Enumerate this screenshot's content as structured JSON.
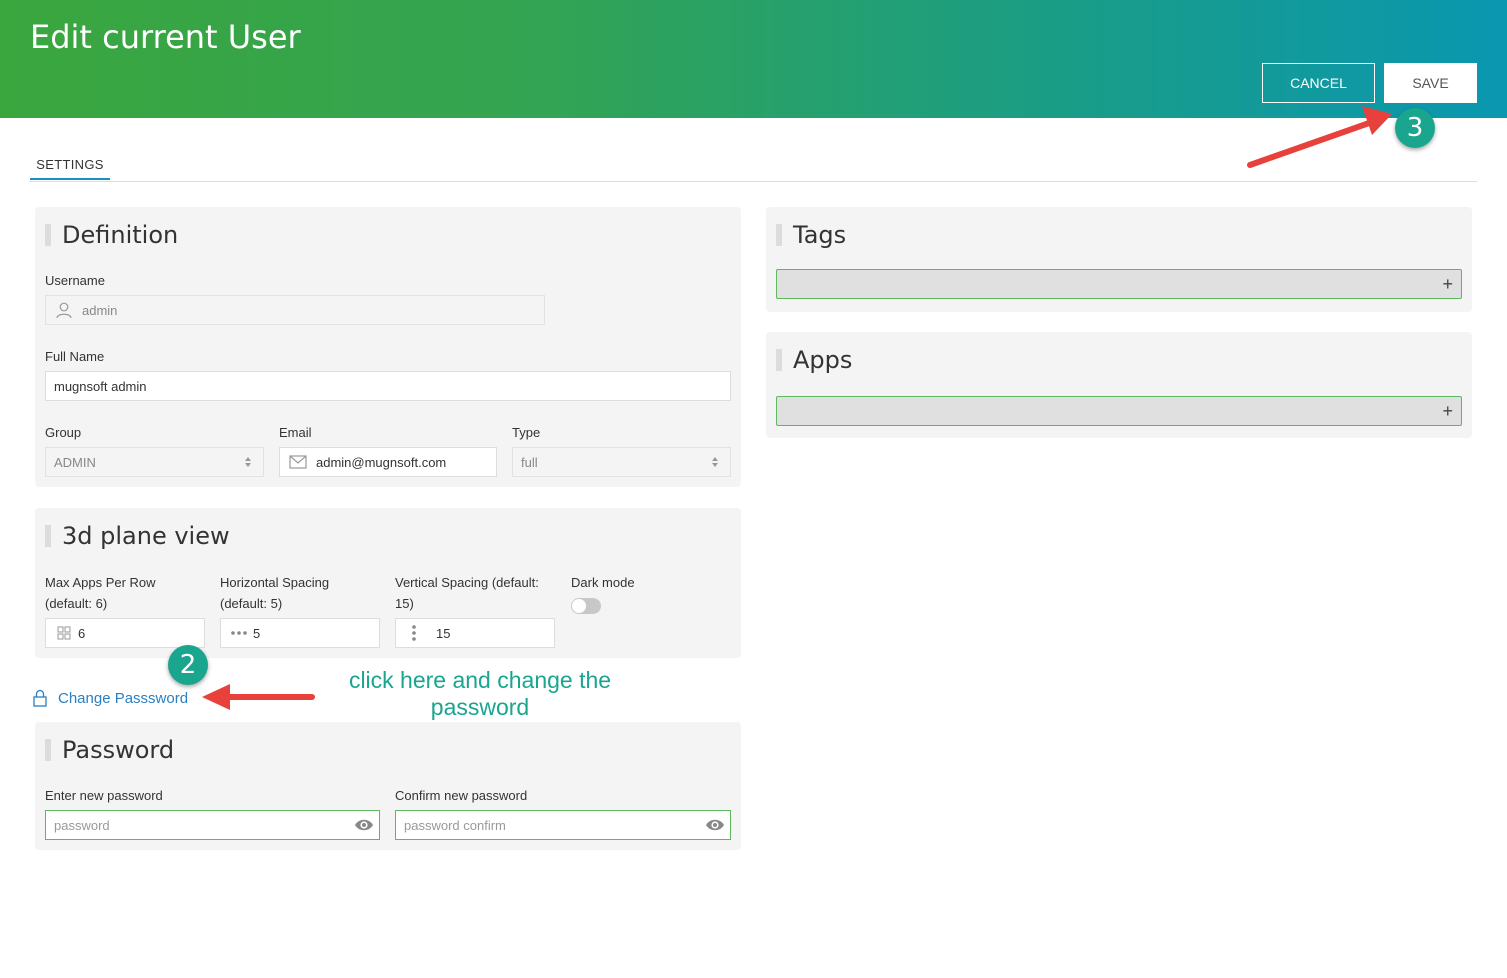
{
  "header": {
    "title": "Edit current User",
    "cancel_label": "CANCEL",
    "save_label": "SAVE"
  },
  "tabs": [
    {
      "label": "SETTINGS",
      "active": true
    }
  ],
  "definition": {
    "title": "Definition",
    "username_label": "Username",
    "username_value": "admin",
    "fullname_label": "Full Name",
    "fullname_value": "mugnsoft admin",
    "group_label": "Group",
    "group_value": "ADMIN",
    "email_label": "Email",
    "email_value": "admin@mugnsoft.com",
    "type_label": "Type",
    "type_value": "full"
  },
  "plane_view": {
    "title": "3d plane view",
    "max_apps_label": "Max Apps Per Row (default: 6)",
    "max_apps_value": "6",
    "h_spacing_label": "Horizontal Spacing (default: 5)",
    "h_spacing_value": "5",
    "v_spacing_label": "Vertical Spacing (default: 15)",
    "v_spacing_value": "15",
    "dark_mode_label": "Dark mode",
    "dark_mode_on": false
  },
  "change_password_label": "Change Passsword",
  "password": {
    "title": "Password",
    "new_label": "Enter new password",
    "new_placeholder": "password",
    "confirm_label": "Confirm new password",
    "confirm_placeholder": "password confirm"
  },
  "tags": {
    "title": "Tags",
    "add_symbol": "+"
  },
  "apps": {
    "title": "Apps",
    "add_symbol": "+"
  },
  "annotations": {
    "step2": "2",
    "step3": "3",
    "instruction": "click here and change the password"
  },
  "colors": {
    "header_start": "#3aa63e",
    "header_end": "#0a97b0",
    "accent_link": "#2b7fc1",
    "badge": "#1aa58f",
    "arrow": "#e8413c",
    "field_valid_border": "#5fb85f"
  },
  "icons": {
    "username": "user-icon",
    "email": "envelope-icon",
    "max_apps": "grid-icon",
    "h_spacing": "dots-horizontal-icon",
    "v_spacing": "dots-vertical-icon",
    "change_password": "lock-icon",
    "password_toggle": "eye-icon",
    "select": "sort-arrows-icon"
  }
}
